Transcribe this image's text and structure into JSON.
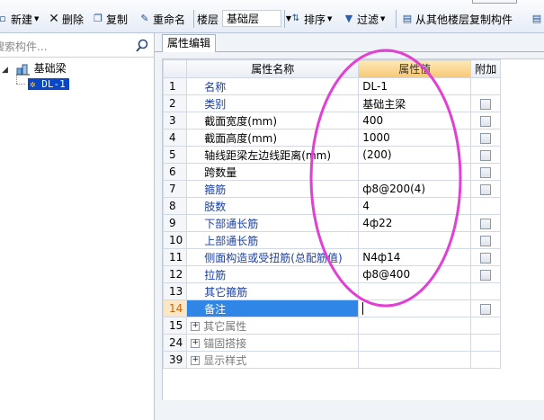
{
  "toolbar": {
    "new_label": "新建",
    "delete_label": "删除",
    "copy_label": "复制",
    "rename_label": "重命名",
    "floor_label": "楼层",
    "floor_value": "基础层",
    "sort_label": "排序",
    "filter_label": "过滤",
    "copy_from_floor_label": "从其他楼层复制构件"
  },
  "sidebar": {
    "search_placeholder": "搜索构件...",
    "tree": {
      "root_label": "基础梁",
      "child_label": "DL-1"
    }
  },
  "main": {
    "tab_label": "属性编辑",
    "columns": {
      "name": "属性名称",
      "value": "属性值",
      "extra": "附加"
    },
    "rows": [
      {
        "num": "1",
        "name": "名称",
        "value": "DL-1",
        "color": "blue",
        "check": false
      },
      {
        "num": "2",
        "name": "类别",
        "value": "基础主梁",
        "color": "blue",
        "check": true
      },
      {
        "num": "3",
        "name": "截面宽度(mm)",
        "value": "400",
        "color": "black",
        "check": true
      },
      {
        "num": "4",
        "name": "截面高度(mm)",
        "value": "1000",
        "color": "black",
        "check": true
      },
      {
        "num": "5",
        "name": "轴线距梁左边线距离(mm)",
        "value": "(200)",
        "color": "black",
        "check": true
      },
      {
        "num": "6",
        "name": "跨数量",
        "value": "",
        "color": "black",
        "check": true
      },
      {
        "num": "7",
        "name": "箍筋",
        "value": "ф8@200(4)",
        "color": "blue",
        "check": true
      },
      {
        "num": "8",
        "name": "肢数",
        "value": "4",
        "color": "blue",
        "check": false
      },
      {
        "num": "9",
        "name": "下部通长筋",
        "value": "4ф22",
        "color": "blue",
        "check": true
      },
      {
        "num": "10",
        "name": "上部通长筋",
        "value": "",
        "color": "blue",
        "check": true
      },
      {
        "num": "11",
        "name": "侧面构造或受扭筋(总配筋值)",
        "value": "N4ф14",
        "color": "blue",
        "check": true
      },
      {
        "num": "12",
        "name": "拉筋",
        "value": "ф8@400",
        "color": "blue",
        "check": true
      },
      {
        "num": "13",
        "name": "其它箍筋",
        "value": "",
        "color": "blue",
        "check": false
      },
      {
        "num": "14",
        "name": "备注",
        "value": "",
        "color": "sel",
        "check": true
      },
      {
        "num": "15",
        "name": "其它属性",
        "value": "",
        "color": "gray",
        "check": false,
        "group": true
      },
      {
        "num": "24",
        "name": "锚固搭接",
        "value": "",
        "color": "gray",
        "check": false,
        "group": true
      },
      {
        "num": "39",
        "name": "显示样式",
        "value": "",
        "color": "gray",
        "check": false,
        "group": true
      }
    ]
  },
  "colors": {
    "selected_node": "#0a47c7",
    "selected_cell": "#2f86e6",
    "header_highlight": "#f7c774",
    "annotation_circle": "#e23fd4"
  }
}
